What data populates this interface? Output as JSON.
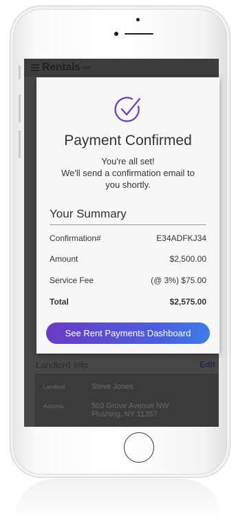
{
  "app": {
    "logo_text": "Rentals",
    "logo_suffix": ".com"
  },
  "modal": {
    "title": "Payment Confirmed",
    "message_lines": [
      "You're all set!",
      "We'll send a confirmation email to",
      "you shortly."
    ],
    "summary_title": "Your Summary",
    "rows": [
      {
        "label": "Confirmation#",
        "value": "E34ADFKJ34"
      },
      {
        "label": "Amount",
        "value": "$2,500.00"
      },
      {
        "label": "Service Fee",
        "value": "(@ 3%) $75.00"
      },
      {
        "label": "Total",
        "value": "$2,575.00"
      }
    ],
    "cta_label": "See Rent Payments Dashboard"
  },
  "landlord": {
    "section_title": "Landlord Info",
    "edit_label": "Edit",
    "rows": [
      {
        "label": "Landlord",
        "value": "Steve Jones"
      },
      {
        "label": "Address",
        "value_line1": "503 Grove Avenue NW",
        "value_line2": "Flushing, NY 11357"
      }
    ]
  },
  "colors": {
    "accent_start": "#6a3bc6",
    "accent_end": "#3d7ce8",
    "check_icon": "#6a3bc6",
    "overlay": "#474747"
  },
  "icons": {
    "menu": "hamburger-icon",
    "confirm": "check-circle-icon"
  }
}
